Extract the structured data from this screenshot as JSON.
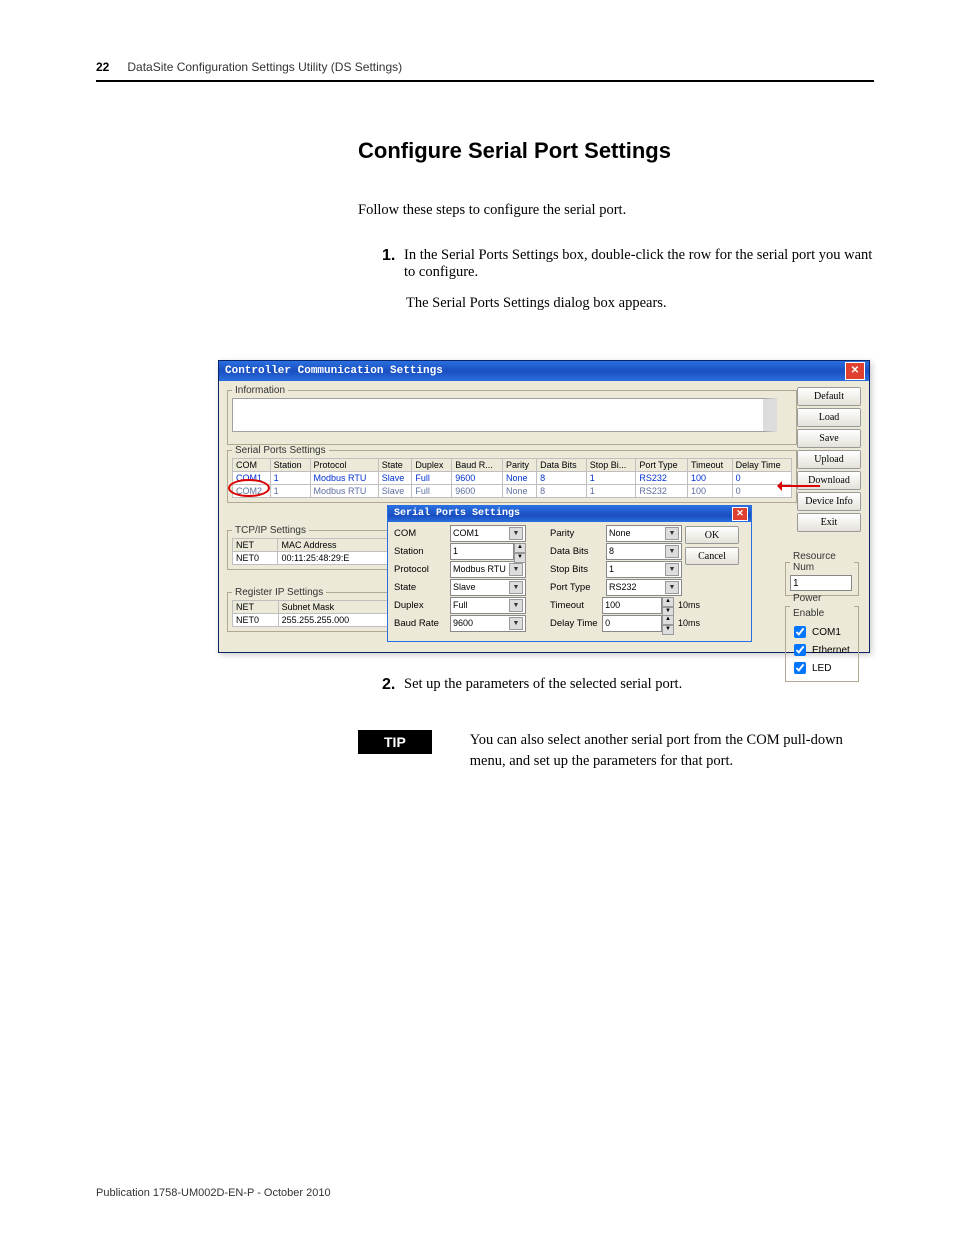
{
  "header": {
    "page_number": "22",
    "chapter": "DataSite Configuration Settings Utility (DS Settings)"
  },
  "section_heading": "Configure Serial Port Settings",
  "intro": "Follow these steps to configure the serial port.",
  "step1": {
    "num": "1.",
    "text": "In the Serial Ports Settings box, double-click the row for the serial port you want to configure.",
    "after": "The Serial Ports Settings dialog box appears."
  },
  "step2": {
    "num": "2.",
    "text": "Set up the parameters of the selected serial port."
  },
  "tip": {
    "label": "TIP",
    "text": "You can also select another serial port from the COM pull-down menu, and set up the parameters for that port."
  },
  "footer": "Publication 1758-UM002D-EN-P - October 2010",
  "win": {
    "title": "Controller Communication Settings",
    "groups": {
      "information": "Information",
      "serial_ports": "Serial Ports Settings",
      "tcpip": "TCP/IP Settings",
      "regip": "Register IP Settings",
      "resource": "Resource Num",
      "power": "Power Enable"
    },
    "buttons": {
      "default": "Default",
      "load": "Load",
      "save": "Save",
      "upload": "Upload",
      "download": "Download",
      "device_info": "Device Info",
      "exit": "Exit"
    },
    "sp_headers": [
      "COM",
      "Station",
      "Protocol",
      "State",
      "Duplex",
      "Baud R...",
      "Parity",
      "Data Bits",
      "Stop Bi...",
      "Port Type",
      "Timeout",
      "Delay Time"
    ],
    "sp_rows": [
      [
        "COM1",
        "1",
        "Modbus RTU",
        "Slave",
        "Full",
        "9600",
        "None",
        "8",
        "1",
        "RS232",
        "100",
        "0"
      ],
      [
        "COM2",
        "1",
        "Modbus RTU",
        "Slave",
        "Full",
        "9600",
        "None",
        "8",
        "1",
        "RS232",
        "100",
        "0"
      ]
    ],
    "tcpip_headers": [
      "NET",
      "MAC Address"
    ],
    "tcpip_row": [
      "NET0",
      "00:11:25:48:29:E"
    ],
    "regip_headers": [
      "NET",
      "Subnet Mask"
    ],
    "regip_row": [
      "NET0",
      "255.255.255.000"
    ],
    "resource_value": "1",
    "power_checks": {
      "com1": "COM1",
      "ethernet": "Ethernet",
      "led": "LED"
    }
  },
  "inner": {
    "title": "Serial Ports Settings",
    "labels": {
      "com": "COM",
      "station": "Station",
      "protocol": "Protocol",
      "state": "State",
      "duplex": "Duplex",
      "baud": "Baud Rate",
      "parity": "Parity",
      "databits": "Data Bits",
      "stopbits": "Stop Bits",
      "porttype": "Port Type",
      "timeout": "Timeout",
      "delay": "Delay Time"
    },
    "values": {
      "com": "COM1",
      "station": "1",
      "protocol": "Modbus RTU",
      "state": "Slave",
      "duplex": "Full",
      "baud": "9600",
      "parity": "None",
      "databits": "8",
      "stopbits": "1",
      "porttype": "RS232",
      "timeout": "100",
      "delay": "0"
    },
    "units": {
      "timeout": "10ms",
      "delay": "10ms"
    },
    "buttons": {
      "ok": "OK",
      "cancel": "Cancel"
    }
  }
}
